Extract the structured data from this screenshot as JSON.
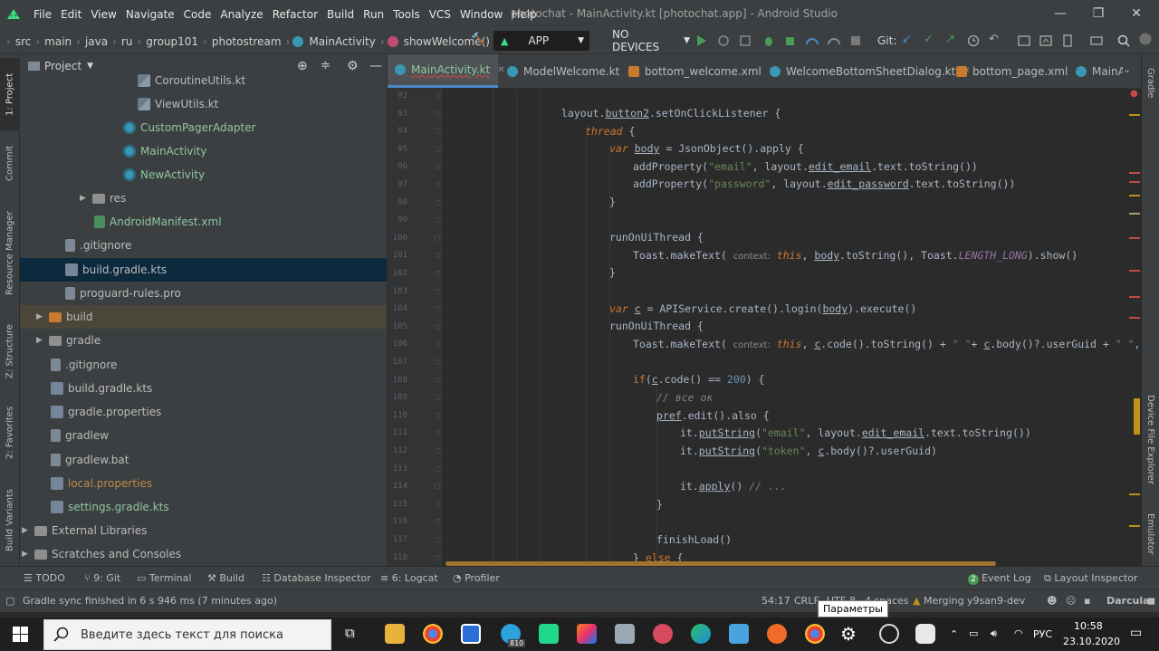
{
  "titlebar": {
    "menu": [
      "File",
      "Edit",
      "View",
      "Navigate",
      "Code",
      "Analyze",
      "Refactor",
      "Build",
      "Run",
      "Tools",
      "VCS",
      "Window",
      "Help"
    ],
    "title": "photochat - MainActivity.kt [photochat.app] - Android Studio",
    "minimize": "—",
    "maximize": "❐",
    "close": "✕"
  },
  "navbar": {
    "crumbs": [
      "src",
      "main",
      "java",
      "ru",
      "group101",
      "photostream",
      "MainActivity",
      "showWelcome()"
    ],
    "run_config": "APP",
    "device": "NO DEVICES",
    "git_label": "Git:"
  },
  "leftstrip": {
    "tabs": [
      "1: Project",
      "Commit",
      "Resource Manager",
      "Z: Structure",
      "2: Favorites",
      "Build Variants"
    ]
  },
  "project": {
    "header": "Project",
    "items": [
      {
        "label": "CoroutineUtils.kt"
      },
      {
        "label": "ViewUtils.kt"
      },
      {
        "label": "CustomPagerAdapter"
      },
      {
        "label": "MainActivity"
      },
      {
        "label": "NewActivity"
      },
      {
        "label": "res"
      },
      {
        "label": "AndroidManifest.xml"
      },
      {
        "label": ".gitignore"
      },
      {
        "label": "build.gradle.kts"
      },
      {
        "label": "proguard-rules.pro"
      },
      {
        "label": "build"
      },
      {
        "label": "gradle"
      },
      {
        "label": ".gitignore"
      },
      {
        "label": "build.gradle.kts"
      },
      {
        "label": "gradle.properties"
      },
      {
        "label": "gradlew"
      },
      {
        "label": "gradlew.bat"
      },
      {
        "label": "local.properties"
      },
      {
        "label": "settings.gradle.kts"
      },
      {
        "label": "External Libraries"
      },
      {
        "label": "Scratches and Consoles"
      }
    ]
  },
  "tabs": [
    "MainActivity.kt",
    "ModelWelcome.kt",
    "bottom_welcome.xml",
    "WelcomeBottomSheetDialog.kt",
    "bottom_page.xml",
    "MainA"
  ],
  "editor": {
    "line_numbers": [
      "92",
      "93",
      "94",
      "95",
      "96",
      "97",
      "98",
      "99",
      "100",
      "101",
      "102",
      "103",
      "104",
      "105",
      "106",
      "107",
      "108",
      "109",
      "110",
      "111",
      "112",
      "113",
      "114",
      "115",
      "116",
      "117",
      "118"
    ]
  },
  "rightstrip": {
    "tabs": [
      "Gradle",
      "Device File Explorer",
      "Emulator"
    ]
  },
  "bottomtools": {
    "items": [
      "TODO",
      "9: Git",
      "Terminal",
      "Build",
      "Database Inspector",
      "6: Logcat",
      "Profiler"
    ],
    "right": [
      "Event Log",
      "Layout Inspector"
    ],
    "event_count": "2"
  },
  "statusbar": {
    "message": "Gradle sync finished in 6 s 946 ms (7 minutes ago)",
    "position": "54:17",
    "line_sep": "CRLF",
    "encoding": "UTF-8",
    "indent": "4 spaces",
    "vcs": "Merging y9san9-dev",
    "theme": "Darcula"
  },
  "tooltip": "Параметры",
  "taskbar": {
    "search_placeholder": "Введите здесь текст для поиска",
    "lang": "РУС",
    "time": "10:58",
    "date": "23.10.2020",
    "telegram_badge": "810"
  }
}
